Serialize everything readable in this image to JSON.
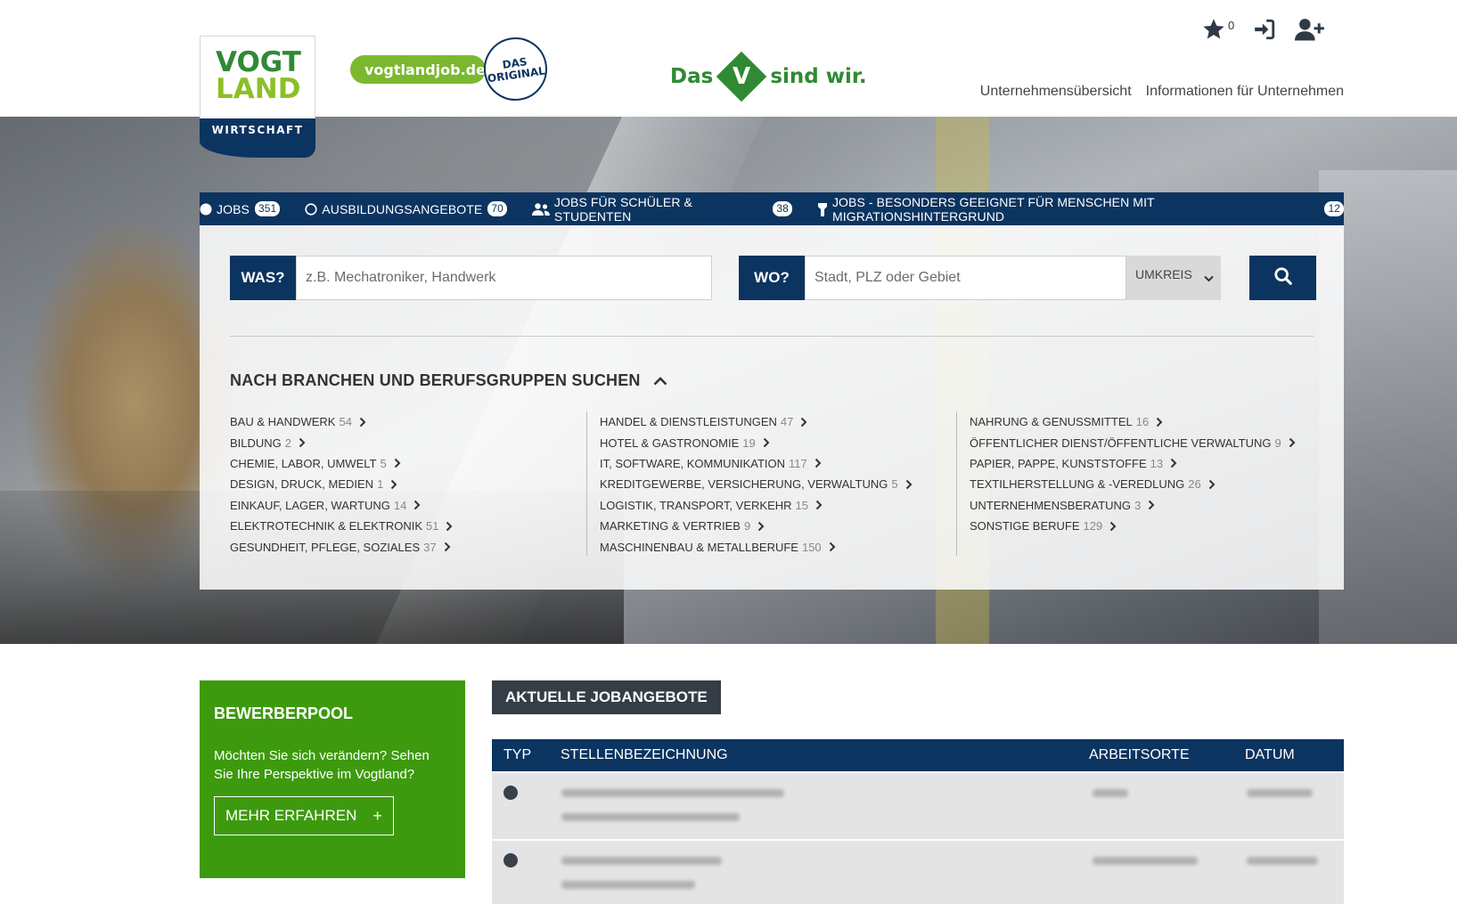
{
  "header": {
    "logo": {
      "line1": "VOGT",
      "line2": "LAND",
      "sub": "WIRTSCHAFT"
    },
    "vogtlandjob": {
      "label": "vogtlandjob.de",
      "badge_line1": "DAS",
      "badge_line2": "ORIGINAL"
    },
    "slogan": {
      "left": "Das",
      "mark": "V",
      "right": "sind wir."
    },
    "favorites_count": "0",
    "nav": [
      "Unternehmensübersicht",
      "Informationen für Unternehmen"
    ]
  },
  "tabs": [
    {
      "label": "JOBS",
      "count": "351",
      "icon": "filled-circle-icon"
    },
    {
      "label": "AUSBILDUNGSANGEBOTE",
      "count": "70",
      "icon": "circle-outline-icon"
    },
    {
      "label": "JOBS FÜR SCHÜLER & STUDENTEN",
      "count": "38",
      "icon": "users-icon"
    },
    {
      "label": "JOBS - BESONDERS GEEIGNET FÜR MENSCHEN MIT MIGRATIONSHINTERGRUND",
      "count": "12",
      "icon": "torch-icon"
    }
  ],
  "search": {
    "what_label": "WAS?",
    "what_placeholder": "z.B. Mechatroniker, Handwerk",
    "where_label": "WO?",
    "where_placeholder": "Stadt, PLZ oder Gebiet",
    "radius_label": "UMKREIS"
  },
  "categories": {
    "title": "NACH BRANCHEN UND BERUFSGRUPPEN SUCHEN",
    "columns": [
      [
        {
          "name": "BAU & HANDWERK",
          "count": "54"
        },
        {
          "name": "BILDUNG",
          "count": "2"
        },
        {
          "name": "CHEMIE, LABOR, UMWELT",
          "count": "5"
        },
        {
          "name": "DESIGN, DRUCK, MEDIEN",
          "count": "1"
        },
        {
          "name": "EINKAUF, LAGER, WARTUNG",
          "count": "14"
        },
        {
          "name": "ELEKTROTECHNIK & ELEKTRONIK",
          "count": "51"
        },
        {
          "name": "GESUNDHEIT, PFLEGE, SOZIALES",
          "count": "37"
        }
      ],
      [
        {
          "name": "HANDEL & DIENSTLEISTUNGEN",
          "count": "47"
        },
        {
          "name": "HOTEL & GASTRONOMIE",
          "count": "19"
        },
        {
          "name": "IT, SOFTWARE, KOMMUNIKATION",
          "count": "117"
        },
        {
          "name": "KREDITGEWERBE, VERSICHERUNG, VERWALTUNG",
          "count": "5"
        },
        {
          "name": "LOGISTIK, TRANSPORT, VERKEHR",
          "count": "15"
        },
        {
          "name": "MARKETING & VERTRIEB",
          "count": "9"
        },
        {
          "name": "MASCHINENBAU & METALLBERUFE",
          "count": "150"
        }
      ],
      [
        {
          "name": "NAHRUNG & GENUSSMITTEL",
          "count": "16"
        },
        {
          "name": "ÖFFENTLICHER DIENST/ÖFFENTLICHE VERWALTUNG",
          "count": "9"
        },
        {
          "name": "PAPIER, PAPPE, KUNSTSTOFFE",
          "count": "13"
        },
        {
          "name": "TEXTILHERSTELLUNG & -VEREDLUNG",
          "count": "26"
        },
        {
          "name": "UNTERNEHMENSBERATUNG",
          "count": "3"
        },
        {
          "name": "SONSTIGE BERUFE",
          "count": "129"
        }
      ]
    ]
  },
  "pool": {
    "title": "BEWERBERPOOL",
    "text": "Möchten Sie sich verändern? Sehen Sie Ihre Perspektive im Vogtland?",
    "button": "MEHR ERFAHREN",
    "button_icon": "+"
  },
  "jobs": {
    "title": "AKTUELLE JOBANGEBOTE",
    "columns": [
      "TYP",
      "STELLENBEZEICHNUNG",
      "ARBEITSORTE",
      "DATUM"
    ]
  },
  "colors": {
    "navy": "#0c3460",
    "green": "#3d9a0e",
    "brand_green": "#2f8a33",
    "lime": "#7cb82f"
  }
}
